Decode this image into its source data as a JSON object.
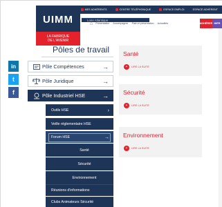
{
  "topbar": {
    "items": [
      {
        "label": "MES ADHÉRENTS"
      },
      {
        "label": "CENTRE TÉLÉPHONIQUE"
      },
      {
        "label": "ESPACE EMPLOI"
      },
      {
        "label": "ESPACE ADHÉRENT"
      }
    ]
  },
  "nav": {
    "items": [
      "Présentation",
      "Accompagner",
      "Paie et présentation",
      "Actualités"
    ],
    "adherer": "ADHÉRER",
    "cta2": "IMPR"
  },
  "logo": {
    "name": "UIMM",
    "region": "Loire Atlantique",
    "tagline_1": "LA FABRIQUE",
    "tagline_2": "DE L'AVENIR"
  },
  "sidebar": {
    "title": "Pôles de travail",
    "poles": [
      {
        "label": "Pôle Compétences",
        "icon": "graduation-icon"
      },
      {
        "label": "Pôle Juridique",
        "icon": "balance-icon"
      },
      {
        "label": "Pôle Industriel HSE",
        "icon": "helmet-icon"
      }
    ],
    "submenu": [
      {
        "label": "Outils HSE"
      },
      {
        "label": "Veille réglementaire HSE"
      },
      {
        "label": "Forum HSE"
      }
    ],
    "forum_children": [
      "Santé",
      "Sécurité",
      "Environnement"
    ],
    "more": [
      {
        "label": "Réunions d'informations"
      },
      {
        "label": "Clubs Animateurs Sécurité"
      }
    ]
  },
  "social": {
    "linkedin": "in",
    "twitter": "t",
    "facebook": "f"
  },
  "cards": [
    {
      "title": "Santé",
      "link": "LIRE LA SUITE"
    },
    {
      "title": "Sécurité",
      "link": "LIRE LA SUITE"
    },
    {
      "title": "Environnement",
      "link": "LIRE LA SUITE"
    }
  ],
  "colors": {
    "navy": "#1f3558",
    "red": "#e3222c"
  }
}
